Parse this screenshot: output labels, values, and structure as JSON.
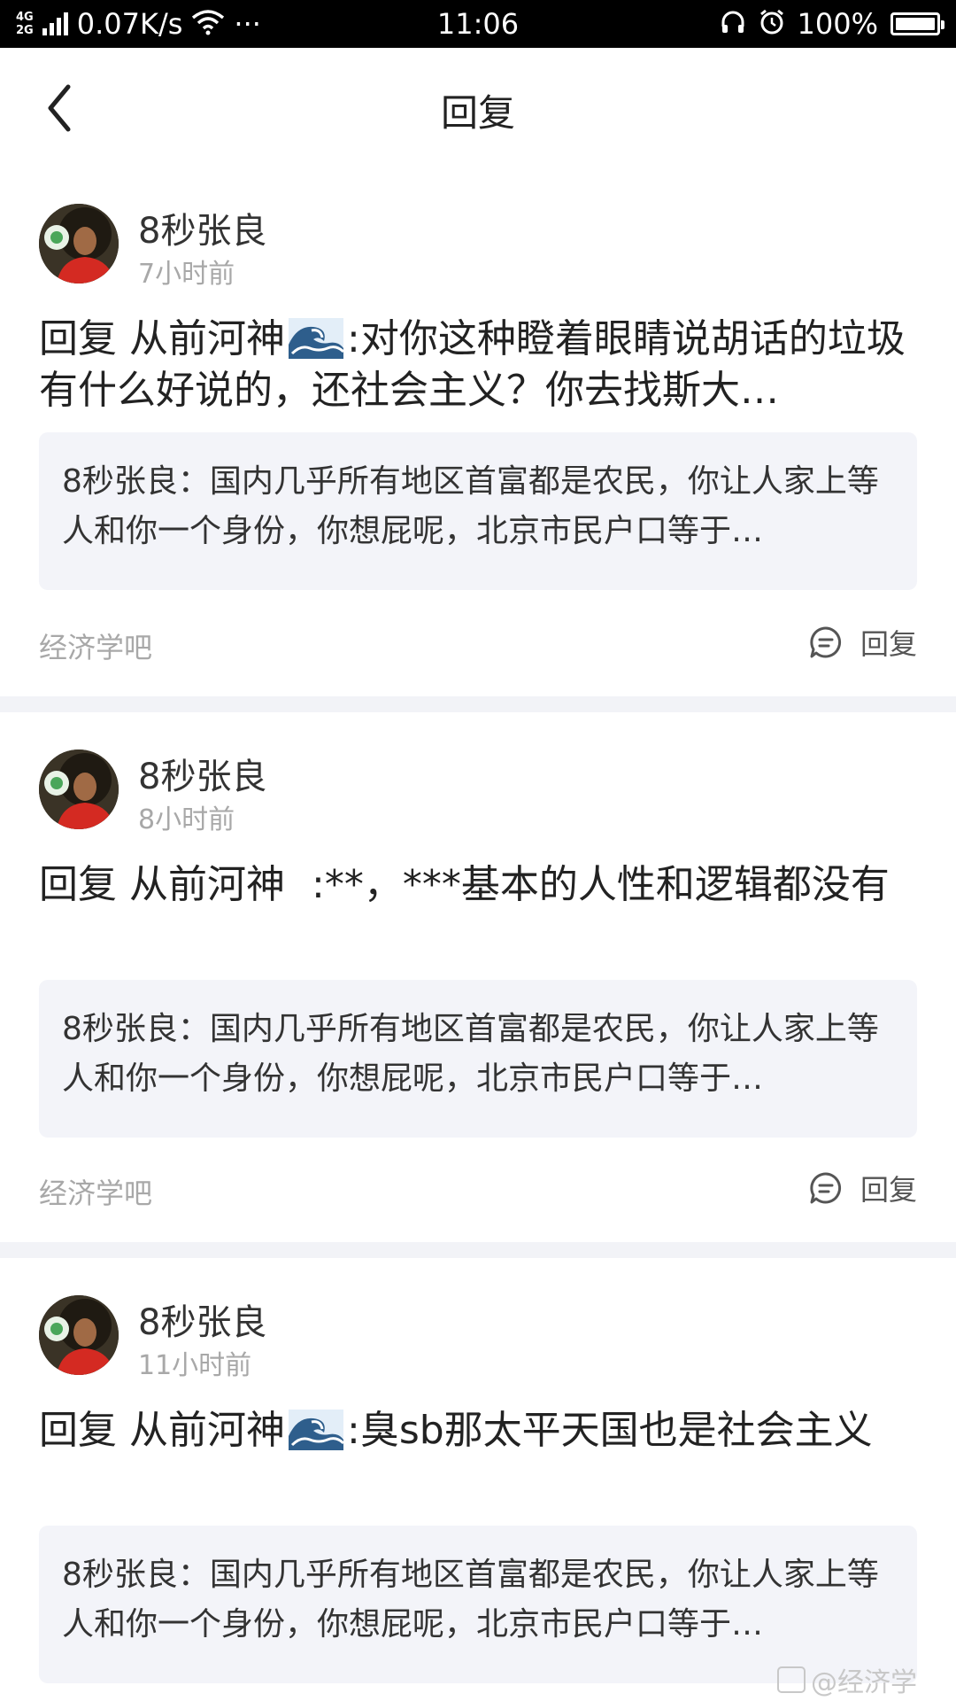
{
  "status_bar": {
    "network_type_top": "4G",
    "network_type_bottom": "2G",
    "speed": "0.07K/s",
    "dots": "···",
    "time": "11:06",
    "battery": "100%"
  },
  "header": {
    "title": "回复",
    "back_icon": "chevron-left-icon"
  },
  "cards": [
    {
      "username": "8秒张良",
      "time": "7小时前",
      "reply_prefix": "回复 从前河神",
      "has_wave_emoji": true,
      "reply_body": ":对你这种瞪着眼睛说胡话的垃圾有什么好说的，还社会主义？你去找斯大…",
      "quote": "8秒张良：国内几乎所有地区首富都是农民，你让人家上等人和你一个身份，你想屁呢，北京市民户口等于…",
      "forum": "经济学吧",
      "reply_label": "回复"
    },
    {
      "username": "8秒张良",
      "time": "8小时前",
      "reply_prefix": "回复 从前河神",
      "has_wave_emoji": false,
      "reply_body": ":**，***基本的人性和逻辑都没有",
      "quote": "8秒张良：国内几乎所有地区首富都是农民，你让人家上等人和你一个身份，你想屁呢，北京市民户口等于…",
      "forum": "经济学吧",
      "reply_label": "回复"
    },
    {
      "username": "8秒张良",
      "time": "11小时前",
      "reply_prefix": "回复 从前河神",
      "has_wave_emoji": true,
      "reply_body": ":臭sb那太平天国也是社会主义",
      "quote": "8秒张良：国内几乎所有地区首富都是农民，你让人家上等人和你一个身份，你想屁呢，北京市民户口等于…"
    }
  ],
  "watermark": "@经济学"
}
